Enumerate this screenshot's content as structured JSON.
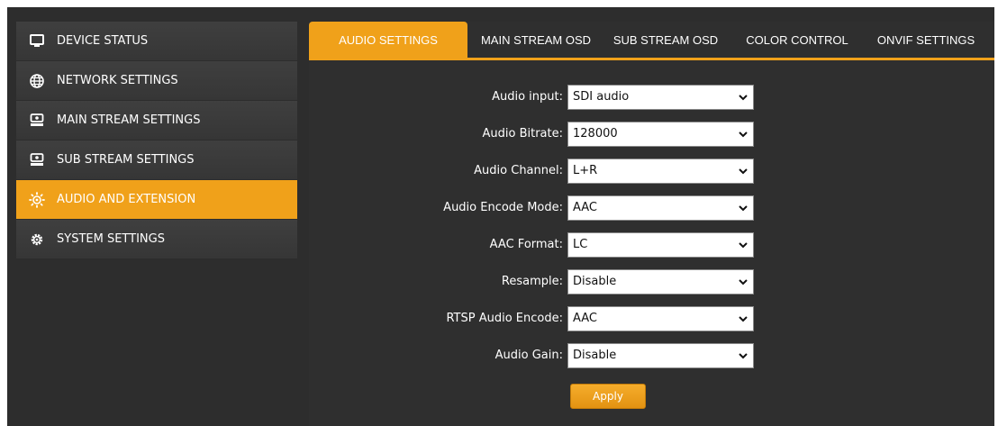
{
  "sidebar": {
    "items": [
      {
        "label": "DEVICE STATUS",
        "icon": "monitor-icon"
      },
      {
        "label": "NETWORK SETTINGS",
        "icon": "globe-icon"
      },
      {
        "label": "MAIN STREAM SETTINGS",
        "icon": "drive-icon"
      },
      {
        "label": "SUB STREAM SETTINGS",
        "icon": "drive-icon"
      },
      {
        "label": "AUDIO AND EXTENSION",
        "icon": "sun-gear-icon",
        "active": true
      },
      {
        "label": "SYSTEM SETTINGS",
        "icon": "gear-icon"
      }
    ]
  },
  "tabs": [
    {
      "label": "AUDIO SETTINGS",
      "active": true
    },
    {
      "label": "MAIN STREAM OSD"
    },
    {
      "label": "SUB STREAM OSD"
    },
    {
      "label": "COLOR CONTROL"
    },
    {
      "label": "ONVIF SETTINGS"
    }
  ],
  "form": {
    "fields": [
      {
        "label": "Audio input:",
        "value": "SDI audio"
      },
      {
        "label": "Audio Bitrate:",
        "value": "128000"
      },
      {
        "label": "Audio Channel:",
        "value": "L+R"
      },
      {
        "label": "Audio Encode Mode:",
        "value": "AAC"
      },
      {
        "label": "AAC Format:",
        "value": "LC"
      },
      {
        "label": "Resample:",
        "value": "Disable"
      },
      {
        "label": "RTSP Audio Encode:",
        "value": "AAC"
      },
      {
        "label": "Audio Gain:",
        "value": "Disable"
      }
    ],
    "apply_label": "Apply"
  },
  "colors": {
    "accent": "#f0a11a",
    "background": "#2d2d2d",
    "sidebar_item": "#3b3b3b"
  }
}
